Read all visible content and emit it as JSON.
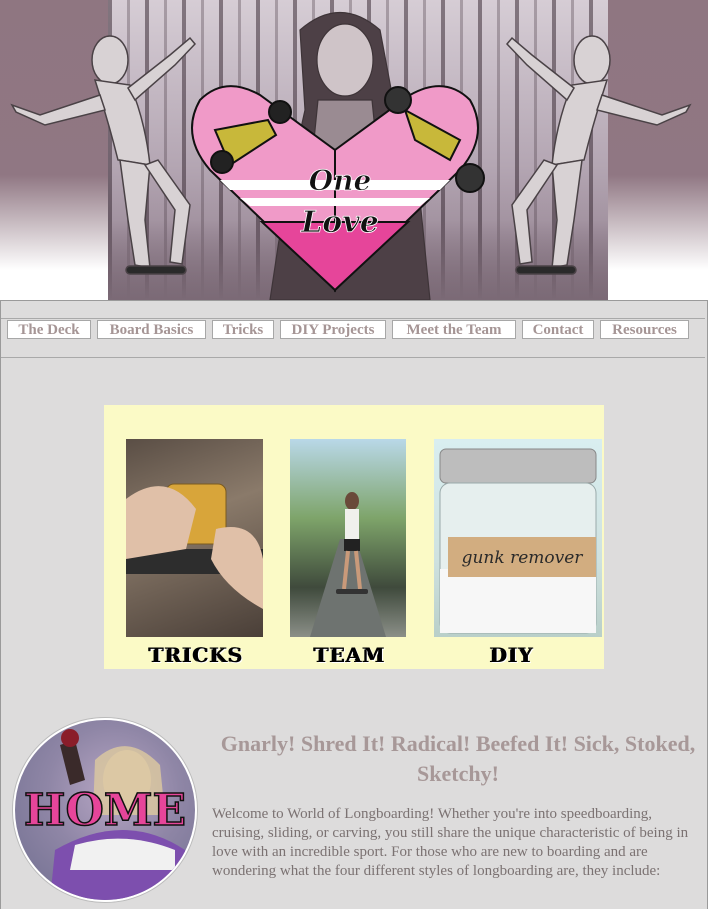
{
  "banner": {
    "logo_line1": "One",
    "logo_line2": "Love"
  },
  "nav": {
    "items": [
      {
        "label": "The Deck"
      },
      {
        "label": "Board Basics"
      },
      {
        "label": "Tricks"
      },
      {
        "label": "DIY Projects"
      },
      {
        "label": "Meet the Team"
      },
      {
        "label": "Contact"
      },
      {
        "label": "Resources"
      }
    ]
  },
  "features": [
    {
      "label": "TRICKS"
    },
    {
      "label": "TEAM"
    },
    {
      "label": "DIY",
      "jar_label": "gunk remover"
    }
  ],
  "home": {
    "badge": "HOME"
  },
  "main": {
    "heading": "Gnarly! Shred It! Radical! Beefed It! Sick, Stoked, Sketchy!",
    "intro": "Welcome to World of Longboarding! Whether you're into speedboarding, cruising, sliding, or carving, you still share the unique characteristic of being in love with an incredible sport. For those who are new to boarding and are wondering what the four different styles of longboarding are, they include:"
  },
  "colors": {
    "accent_pink": "#e6459a",
    "nav_text": "#a59595",
    "page_bg": "#dddcdc",
    "feature_bg": "#fbfac6"
  }
}
